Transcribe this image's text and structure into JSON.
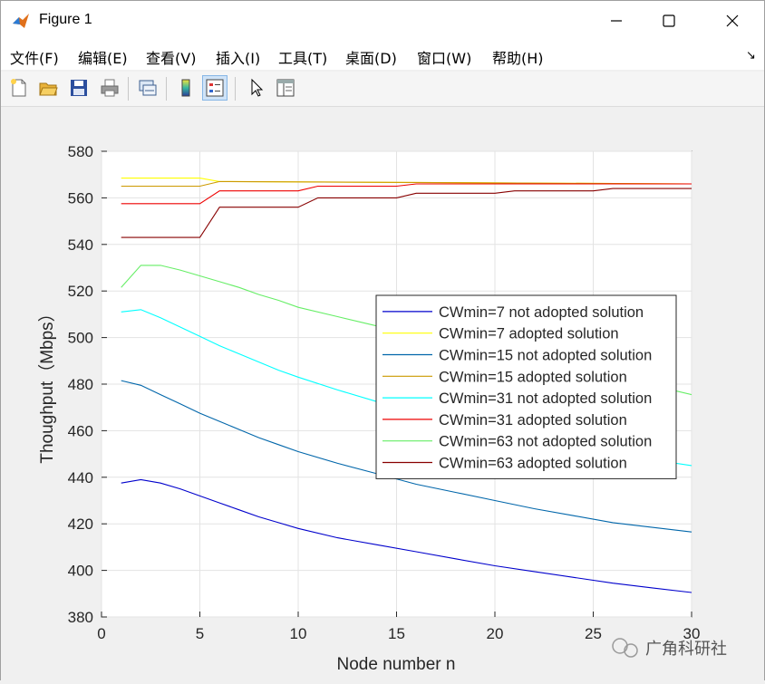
{
  "window": {
    "title": "Figure 1",
    "controls": {
      "minimize": "—",
      "maximize": "☐",
      "close": "✕"
    }
  },
  "menu": {
    "items": [
      "文件(F)",
      "编辑(E)",
      "查看(V)",
      "插入(I)",
      "工具(T)",
      "桌面(D)",
      "窗口(W)",
      "帮助(H)"
    ],
    "dock_arrow": "↘"
  },
  "toolbar": {
    "buttons": [
      {
        "name": "new-figure-icon"
      },
      {
        "name": "open-file-icon"
      },
      {
        "name": "save-icon"
      },
      {
        "name": "print-icon"
      },
      {
        "name": "link-plot-icon"
      },
      {
        "name": "colorbar-icon"
      },
      {
        "name": "legend-icon",
        "active": true
      },
      {
        "name": "pointer-icon"
      },
      {
        "name": "property-inspector-icon"
      }
    ]
  },
  "chart_data": {
    "type": "line",
    "title": "",
    "xlabel": "Node number n",
    "ylabel": "Thoughput（Mbps）",
    "xlim": [
      0,
      30
    ],
    "ylim": [
      380,
      580
    ],
    "xticks": [
      0,
      5,
      10,
      15,
      20,
      25,
      30
    ],
    "yticks": [
      380,
      400,
      420,
      440,
      460,
      480,
      500,
      520,
      540,
      560,
      580
    ],
    "grid": true,
    "legend_position": "right",
    "series": [
      {
        "name": "CWmin=7 not adopted solution",
        "color": "#0000cc",
        "x": [
          1,
          2,
          3,
          4,
          5,
          6,
          7,
          8,
          9,
          10,
          12,
          14,
          16,
          18,
          20,
          22,
          24,
          26,
          28,
          30
        ],
        "y": [
          437.5,
          439,
          437.5,
          435,
          432,
          429,
          426,
          423,
          420.5,
          418,
          414,
          411,
          408,
          405,
          402,
          399.5,
          397,
          394.5,
          392.5,
          390.5
        ]
      },
      {
        "name": "CWmin=7 adopted solution",
        "color": "#ffff00",
        "x": [
          1,
          5,
          6,
          30
        ],
        "y": [
          568.5,
          568.5,
          567,
          566
        ]
      },
      {
        "name": "CWmin=15 not adopted solution",
        "color": "#0066aa",
        "x": [
          1,
          2,
          3,
          4,
          5,
          6,
          7,
          8,
          9,
          10,
          12,
          14,
          16,
          18,
          20,
          22,
          24,
          26,
          28,
          30
        ],
        "y": [
          481.5,
          479.5,
          475.5,
          471.5,
          467.5,
          464,
          460.5,
          457,
          454,
          451,
          446,
          441.5,
          437,
          433.5,
          430,
          426.5,
          423.5,
          420.5,
          418.5,
          416.5
        ]
      },
      {
        "name": "CWmin=15 adopted solution",
        "color": "#cc9900",
        "x": [
          1,
          5,
          6,
          30
        ],
        "y": [
          565,
          565,
          567,
          566
        ]
      },
      {
        "name": "CWmin=31 not adopted solution",
        "color": "#00ffff",
        "x": [
          1,
          2,
          3,
          4,
          5,
          6,
          7,
          8,
          9,
          10,
          12,
          14,
          16,
          18,
          20,
          22,
          24,
          26,
          28,
          30
        ],
        "y": [
          511,
          512,
          508.5,
          504.5,
          500.5,
          496.5,
          493,
          489.5,
          486,
          483,
          477.5,
          472.5,
          468,
          464,
          460,
          456.5,
          453,
          450,
          447.5,
          445
        ]
      },
      {
        "name": "CWmin=31 adopted solution",
        "color": "#ee0000",
        "x": [
          1,
          5,
          6,
          10,
          11,
          15,
          16,
          20,
          21,
          25,
          26,
          30
        ],
        "y": [
          557.5,
          557.5,
          563,
          563,
          565,
          565,
          566,
          566,
          566,
          566,
          566,
          566
        ]
      },
      {
        "name": "CWmin=63 not adopted solution",
        "color": "#66ee66",
        "x": [
          1,
          2,
          3,
          4,
          5,
          6,
          7,
          8,
          9,
          10,
          12,
          14,
          16,
          18,
          20,
          22,
          24,
          26,
          28,
          30
        ],
        "y": [
          521.5,
          531,
          531,
          529,
          526.5,
          524,
          521.5,
          518.5,
          516,
          513,
          509,
          505,
          501,
          497.5,
          494,
          490.5,
          487.5,
          483.5,
          479.5,
          475.5
        ]
      },
      {
        "name": "CWmin=63 adopted solution",
        "color": "#880000",
        "x": [
          1,
          5,
          6,
          10,
          11,
          15,
          16,
          20,
          21,
          25,
          26,
          30
        ],
        "y": [
          543,
          543,
          556,
          556,
          560,
          560,
          562,
          562,
          563,
          563,
          564,
          564
        ]
      }
    ]
  },
  "watermark": {
    "text": "广角科研社"
  }
}
